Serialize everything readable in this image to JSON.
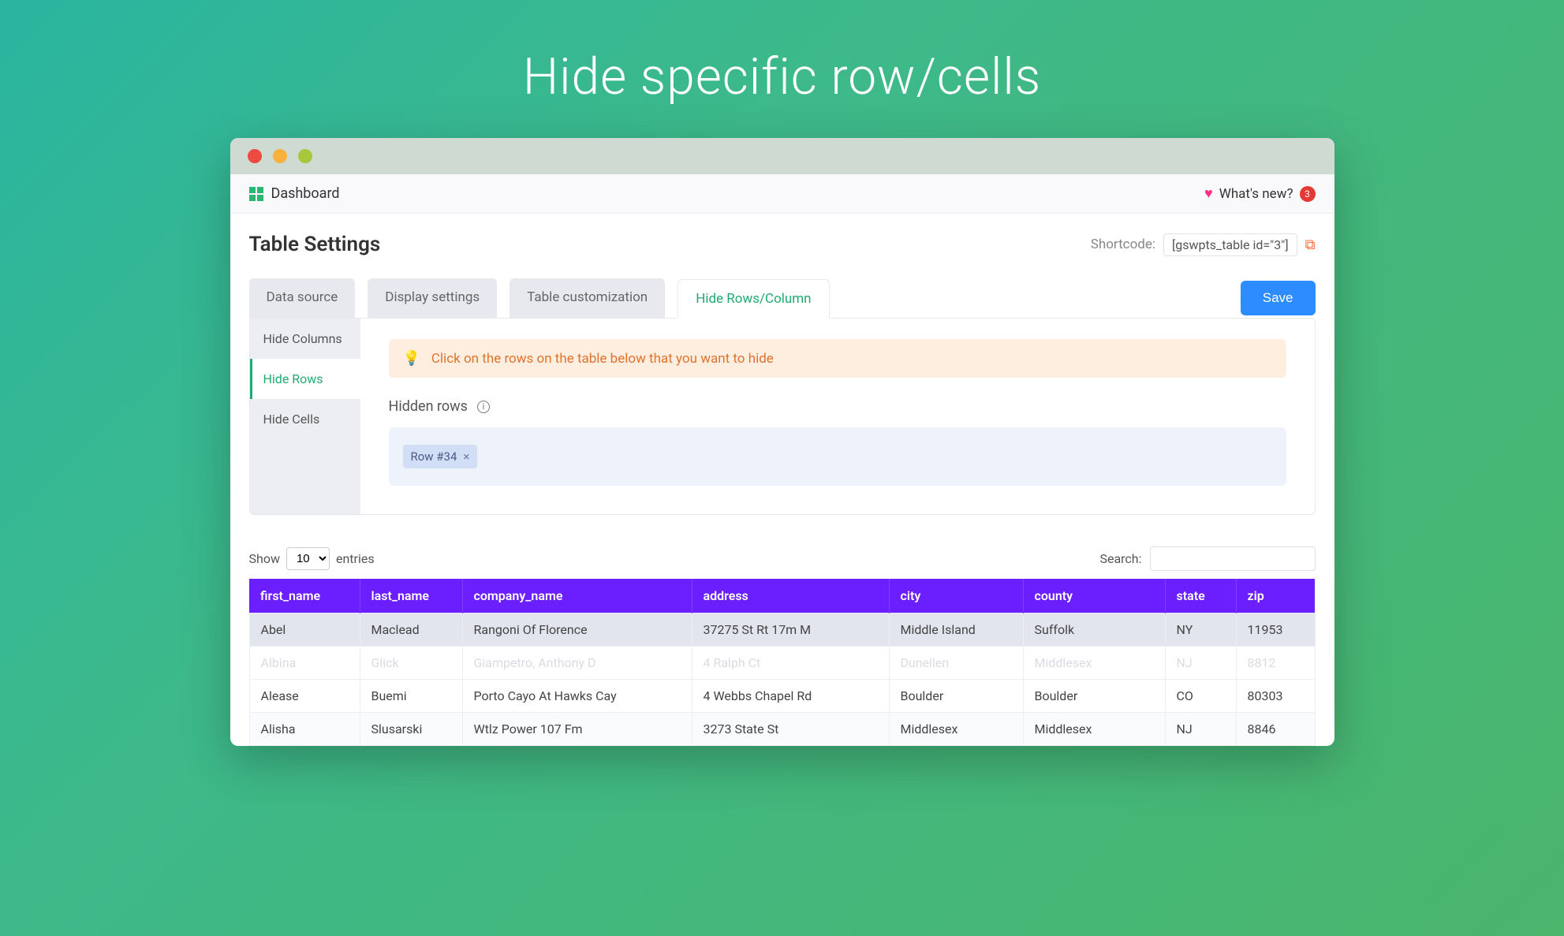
{
  "hero": {
    "title": "Hide specific row/cells"
  },
  "topbar": {
    "dashboard": "Dashboard",
    "whats_new": "What's new?",
    "count": "3"
  },
  "settings": {
    "title": "Table Settings",
    "shortcode_label": "Shortcode:",
    "shortcode_value": "[gswpts_table id=\"3\"]"
  },
  "tabs": {
    "data_source": "Data source",
    "display_settings": "Display settings",
    "table_customization": "Table customization",
    "hide_rows_column": "Hide Rows/Column",
    "save": "Save"
  },
  "side_tabs": {
    "hide_columns": "Hide Columns",
    "hide_rows": "Hide Rows",
    "hide_cells": "Hide Cells"
  },
  "panel": {
    "banner": "Click on the rows on the table below that you want to hide",
    "hidden_rows_label": "Hidden rows",
    "chip_label": "Row #34",
    "chip_x": "×"
  },
  "table_controls": {
    "show": "Show",
    "show_value": "10",
    "entries": "entries",
    "search": "Search:",
    "search_value": ""
  },
  "columns": {
    "first_name": "first_name",
    "last_name": "last_name",
    "company_name": "company_name",
    "address": "address",
    "city": "city",
    "county": "county",
    "state": "state",
    "zip": "zip"
  },
  "rows": [
    {
      "state": "selected",
      "first_name": "Abel",
      "last_name": "Maclead",
      "company_name": "Rangoni Of Florence",
      "address": "37275 St Rt 17m M",
      "city": "Middle Island",
      "county": "Suffolk",
      "state_col": "NY",
      "zip": "11953"
    },
    {
      "state": "hidden",
      "first_name": "Albina",
      "last_name": "Glick",
      "company_name": "Giampetro, Anthony D",
      "address": "4 Ralph Ct",
      "city": "Dunellen",
      "county": "Middlesex",
      "state_col": "NJ",
      "zip": "8812"
    },
    {
      "state": "normal",
      "first_name": "Alease",
      "last_name": "Buemi",
      "company_name": "Porto Cayo At Hawks Cay",
      "address": "4 Webbs Chapel Rd",
      "city": "Boulder",
      "county": "Boulder",
      "state_col": "CO",
      "zip": "80303"
    },
    {
      "state": "normal",
      "first_name": "Alisha",
      "last_name": "Slusarski",
      "company_name": "Wtlz Power 107 Fm",
      "address": "3273 State St",
      "city": "Middlesex",
      "county": "Middlesex",
      "state_col": "NJ",
      "zip": "8846"
    }
  ]
}
